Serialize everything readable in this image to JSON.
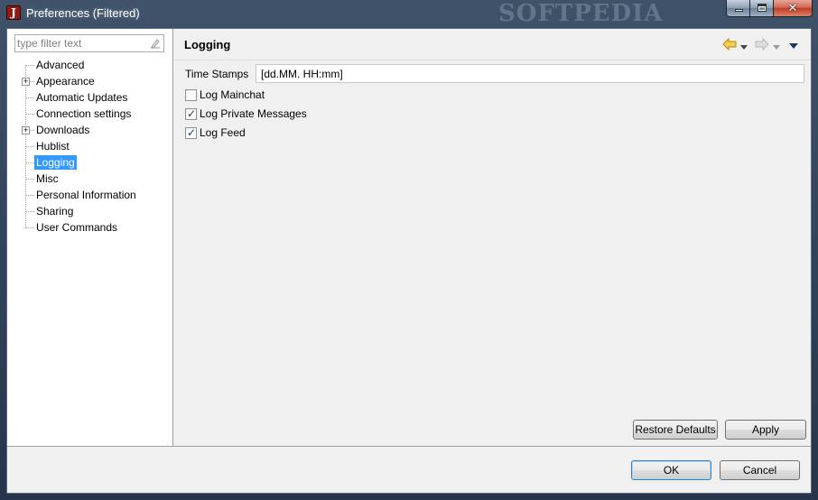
{
  "window": {
    "title": "Preferences (Filtered)",
    "app_icon_letter": "J",
    "watermark": "SOFTPEDIA"
  },
  "filter": {
    "placeholder": "type filter text",
    "value": ""
  },
  "tree": {
    "items": [
      {
        "label": "Advanced",
        "expandable": false,
        "selected": false
      },
      {
        "label": "Appearance",
        "expandable": true,
        "selected": false
      },
      {
        "label": "Automatic Updates",
        "expandable": false,
        "selected": false
      },
      {
        "label": "Connection settings",
        "expandable": false,
        "selected": false
      },
      {
        "label": "Downloads",
        "expandable": true,
        "selected": false
      },
      {
        "label": "Hublist",
        "expandable": false,
        "selected": false
      },
      {
        "label": "Logging",
        "expandable": false,
        "selected": true
      },
      {
        "label": "Misc",
        "expandable": false,
        "selected": false
      },
      {
        "label": "Personal Information",
        "expandable": false,
        "selected": false
      },
      {
        "label": "Sharing",
        "expandable": false,
        "selected": false
      },
      {
        "label": "User Commands",
        "expandable": false,
        "selected": false
      }
    ]
  },
  "page": {
    "title": "Logging",
    "time_stamps_label": "Time Stamps",
    "time_stamps_value": "[dd.MM. HH:mm]",
    "checkboxes": [
      {
        "label": "Log Mainchat",
        "checked": false
      },
      {
        "label": "Log Private Messages",
        "checked": true
      },
      {
        "label": "Log Feed",
        "checked": true
      }
    ],
    "restore_defaults": "Restore Defaults",
    "apply": "Apply"
  },
  "footer": {
    "ok": "OK",
    "cancel": "Cancel"
  },
  "colors": {
    "selection": "#3399ff",
    "back_arrow": "#e8b30a",
    "forward_arrow": "#b8b8b8"
  }
}
